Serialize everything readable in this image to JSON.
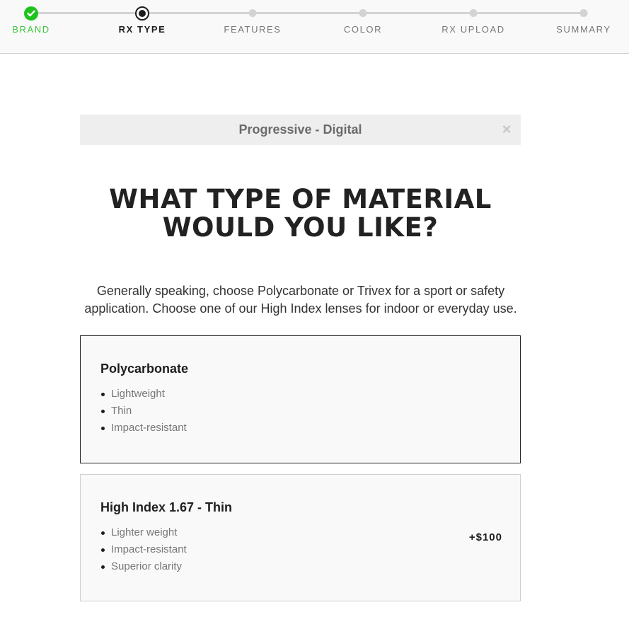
{
  "stepper": {
    "steps": [
      {
        "label": "BRAND",
        "state": "done"
      },
      {
        "label": "RX TYPE",
        "state": "current"
      },
      {
        "label": "FEATURES",
        "state": "todo"
      },
      {
        "label": "COLOR",
        "state": "todo"
      },
      {
        "label": "RX UPLOAD",
        "state": "todo"
      },
      {
        "label": "SUMMARY",
        "state": "todo"
      }
    ]
  },
  "selection_chip": {
    "label": "Progressive - Digital",
    "close_icon": "×"
  },
  "heading": "WHAT TYPE OF MATERIAL WOULD YOU LIKE?",
  "description": "Generally speaking, choose Polycarbonate or Trivex for a sport or safety application. Choose one of our High Index lenses for indoor or everyday use.",
  "options": [
    {
      "title": "Polycarbonate",
      "features": [
        "Lightweight",
        "Thin",
        "Impact-resistant"
      ],
      "price": "",
      "selected": true
    },
    {
      "title": "High Index 1.67 - Thin",
      "features": [
        "Lighter weight",
        "Impact-resistant",
        "Superior clarity"
      ],
      "price": "+$100",
      "selected": false
    }
  ],
  "colors": {
    "done": "#1ec31e",
    "current": "#1e1e1e",
    "todo": "#d3d3d3"
  }
}
